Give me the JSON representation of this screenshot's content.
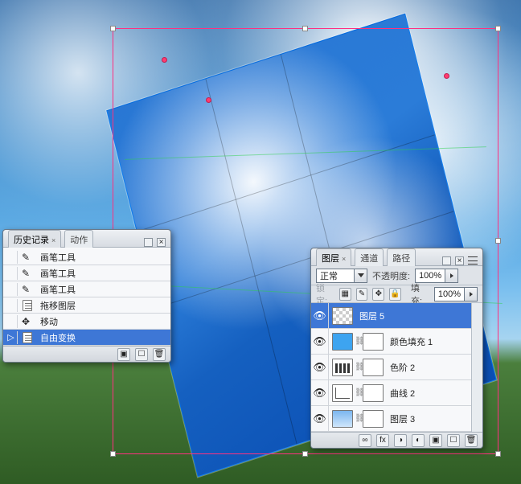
{
  "history_panel": {
    "tabs": [
      {
        "label": "历史记录",
        "active": true,
        "closable": true
      },
      {
        "label": "动作",
        "active": false,
        "closable": false
      }
    ],
    "items": [
      {
        "icon": "brush-icon",
        "label": "画笔工具",
        "selected": false
      },
      {
        "icon": "brush-icon",
        "label": "画笔工具",
        "selected": false
      },
      {
        "icon": "brush-icon",
        "label": "画笔工具",
        "selected": false
      },
      {
        "icon": "doc-icon",
        "label": "拖移图层",
        "selected": false
      },
      {
        "icon": "move-icon",
        "label": "移动",
        "selected": false
      },
      {
        "icon": "doc-icon",
        "label": "自由变换",
        "selected": true
      }
    ],
    "current_marker": "▷"
  },
  "layers_panel": {
    "tabs": [
      {
        "label": "图层",
        "active": true,
        "closable": true
      },
      {
        "label": "通道",
        "active": false,
        "closable": false
      },
      {
        "label": "路径",
        "active": false,
        "closable": false
      }
    ],
    "opts": {
      "blend_label": "正常",
      "opacity_label": "不透明度:",
      "opacity_value": "100%",
      "lock_label": "锁定:",
      "fill_label": "填充:",
      "fill_value": "100%"
    },
    "layers": [
      {
        "visible": true,
        "thumbs": [
          "checker"
        ],
        "label": "图层 5",
        "selected": true
      },
      {
        "visible": true,
        "thumbs": [
          "solid",
          "mask"
        ],
        "label": "颜色填充 1",
        "selected": false,
        "linked": true
      },
      {
        "visible": true,
        "thumbs": [
          "levels",
          "mask"
        ],
        "label": "色阶 2",
        "selected": false,
        "linked": true
      },
      {
        "visible": true,
        "thumbs": [
          "curve",
          "mask"
        ],
        "label": "曲线 2",
        "selected": false,
        "linked": true
      },
      {
        "visible": true,
        "thumbs": [
          "sky",
          "mask"
        ],
        "label": "图层 3",
        "selected": false,
        "linked": true
      }
    ]
  }
}
